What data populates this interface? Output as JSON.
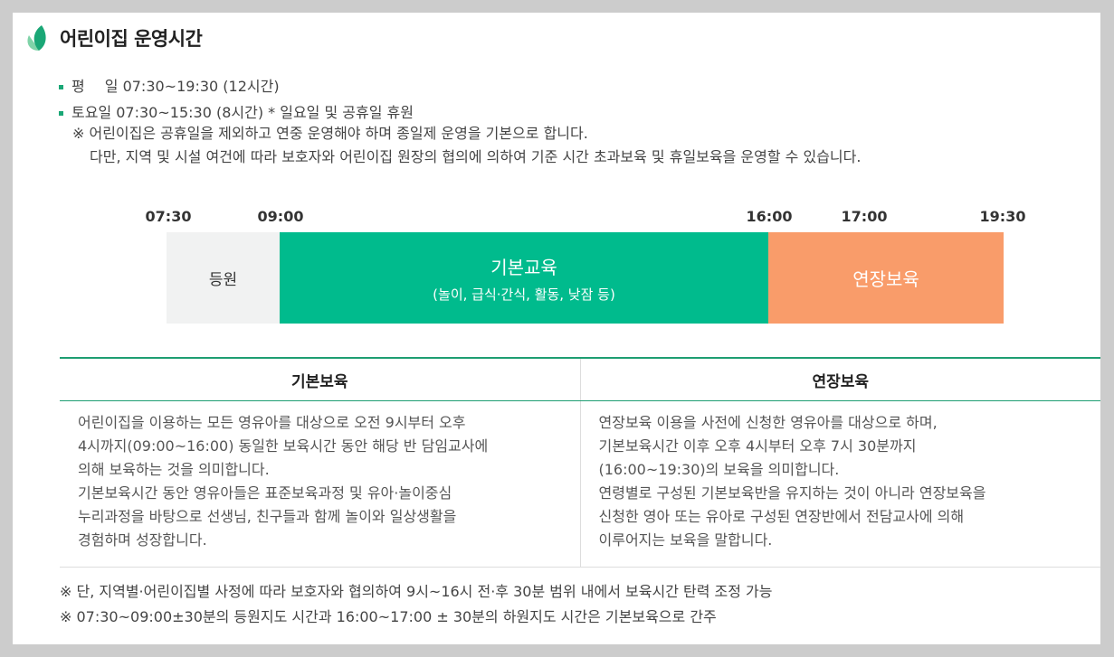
{
  "header": {
    "title": "어린이집 운영시간"
  },
  "hours": {
    "weekday_label": "평",
    "weekday_label2": "일",
    "weekday_time": "07:30~19:30 (12시간)",
    "saturday": "토요일 07:30~15:30 (8시간) * 일요일 및 공휴일 휴원",
    "note_1": "※ 어린이집은 공휴일을 제외하고 연중 운영해야 하며 종일제 운영을 기본으로 합니다.",
    "note_2": "다만, 지역 및 시설 여건에 따라 보호자와 어린이집 원장의 협의에 의하여 기준 시간 초과보육 및 휴일보육을 운영할 수 있습니다."
  },
  "timeline": {
    "times": [
      "07:30",
      "09:00",
      "16:00",
      "17:00",
      "19:30"
    ],
    "enroll_label": "등원",
    "basic_label": "기본교육",
    "basic_sub": "(놀이, 급식·간식, 활동, 낮잠 등)",
    "extended_label": "연장보육"
  },
  "table": {
    "headers": [
      "기본보육",
      "연장보육"
    ],
    "basic_lines": [
      "어린이집을 이용하는 모든 영유아를 대상으로 오전 9시부터 오후",
      "4시까지(09:00~16:00) 동일한 보육시간 동안 해당 반 담임교사에",
      "의해 보육하는 것을 의미합니다.",
      "기본보육시간 동안 영유아들은 표준보육과정 및 유아·놀이중심",
      "누리과정을 바탕으로 선생님, 친구들과 함께 놀이와 일상생활을",
      "경험하며 성장합니다."
    ],
    "extended_lines": [
      "연장보육 이용을 사전에 신청한 영유아를 대상으로 하며,",
      "기본보육시간 이후 오후 4시부터 오후 7시 30분까지",
      "(16:00~19:30)의 보육을 의미합니다.",
      "연령별로 구성된 기본보육반을 유지하는 것이 아니라 연장보육을",
      "신청한 영아 또는 유아로 구성된 연장반에서 전담교사에 의해",
      "이루어지는 보육을 말합니다."
    ]
  },
  "footnotes": [
    "※ 단, 지역별·어린이집별 사정에 따라 보호자와 협의하여 9시~16시 전·후 30분 범위 내에서 보육시간 탄력 조정 가능",
    "※ 07:30~09:00±30분의 등원지도 시간과 16:00~17:00 ± 30분의 하원지도 시간은 기본보육으로 간주"
  ],
  "colors": {
    "accent": "#1aa776",
    "basic": "#00bb8d",
    "extended": "#f99c6a",
    "enroll": "#f1f2f2"
  },
  "icons": {
    "title_icon": "leaf-icon"
  }
}
